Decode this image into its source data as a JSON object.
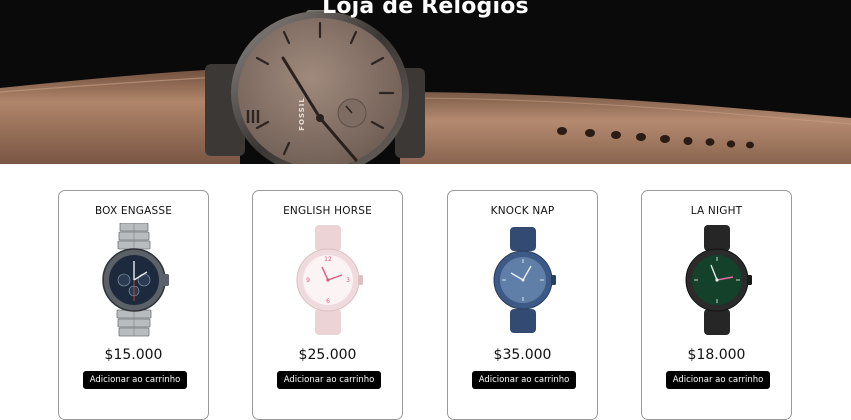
{
  "header": {
    "title": "Loja de Relógios",
    "hero_brand": "FOSSIL"
  },
  "products": [
    {
      "name": "BOX ENGASSE",
      "price": "$15.000",
      "button_label": "Adicionar ao carrinho",
      "image_icon": "watch-steel-chrono"
    },
    {
      "name": "ENGLISH HORSE",
      "price": "$25.000",
      "button_label": "Adicionar ao carrinho",
      "image_icon": "watch-pink"
    },
    {
      "name": "KNOCK NAP",
      "price": "$35.000",
      "button_label": "Adicionar ao carrinho",
      "image_icon": "watch-blue"
    },
    {
      "name": "LA NIGHT",
      "price": "$18.000",
      "button_label": "Adicionar ao carrinho",
      "image_icon": "watch-black-green"
    }
  ],
  "colors": {
    "hero_bg": "#0b0a0a",
    "strap": "#a4775d",
    "dial": "#8f7a6e",
    "button_bg": "#000000",
    "card_border": "#9a9a9a"
  }
}
